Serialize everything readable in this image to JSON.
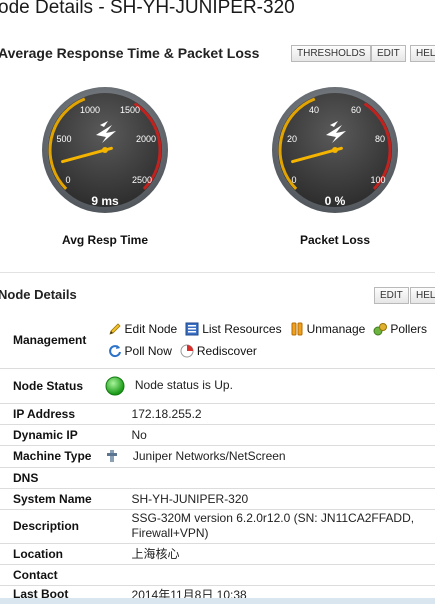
{
  "page": {
    "title": "ode Details - SH-YH-JUNIPER-320"
  },
  "response_panel": {
    "title": "Average Response Time & Packet Loss",
    "buttons": {
      "thresholds": "THRESHOLDS",
      "edit": "EDIT",
      "help": "HEL"
    },
    "gauges": [
      {
        "caption": "Avg Resp Time",
        "reading": "9 ms",
        "value": 9,
        "range": [
          0,
          2500
        ],
        "ticks": [
          "0",
          "500",
          "1000",
          "1500",
          "2000",
          "2500"
        ]
      },
      {
        "caption": "Packet Loss",
        "reading": "0 %",
        "value": 0,
        "range": [
          0,
          100
        ],
        "ticks": [
          "0",
          "20",
          "40",
          "60",
          "80",
          "100"
        ]
      }
    ]
  },
  "node_panel": {
    "title": "Node Details",
    "buttons": {
      "edit": "EDIT",
      "help": "HEL"
    },
    "management": {
      "label": "Management",
      "links": {
        "edit_node": "Edit Node",
        "list_resources": "List Resources",
        "unmanage": "Unmanage",
        "pollers": "Pollers",
        "poll_now": "Poll Now",
        "rediscover": "Rediscover"
      }
    },
    "rows": {
      "node_status": {
        "label": "Node Status",
        "value": "Node status is Up."
      },
      "ip_address": {
        "label": "IP Address",
        "value": "172.18.255.2"
      },
      "dynamic_ip": {
        "label": "Dynamic IP",
        "value": "No"
      },
      "machine_type": {
        "label": "Machine Type",
        "value": "Juniper Networks/NetScreen"
      },
      "dns": {
        "label": "DNS",
        "value": ""
      },
      "system_name": {
        "label": "System Name",
        "value": "SH-YH-JUNIPER-320"
      },
      "description": {
        "label": "Description",
        "value": "SSG-320M version 6.2.0r12.0 (SN: JN11CA2FFADD, Firewall+VPN)"
      },
      "location": {
        "label": "Location",
        "value": "上海核心"
      },
      "contact": {
        "label": "Contact",
        "value": ""
      },
      "last_boot": {
        "label": "Last Boot",
        "value": "2014年11月8日 10:38"
      }
    }
  },
  "colors": {
    "needle": "#f5b400",
    "gauge_face": "#3a3a3a",
    "status_up": "#21b521",
    "red_zone": "#c0231f",
    "yellow_zone": "#e2a400"
  }
}
